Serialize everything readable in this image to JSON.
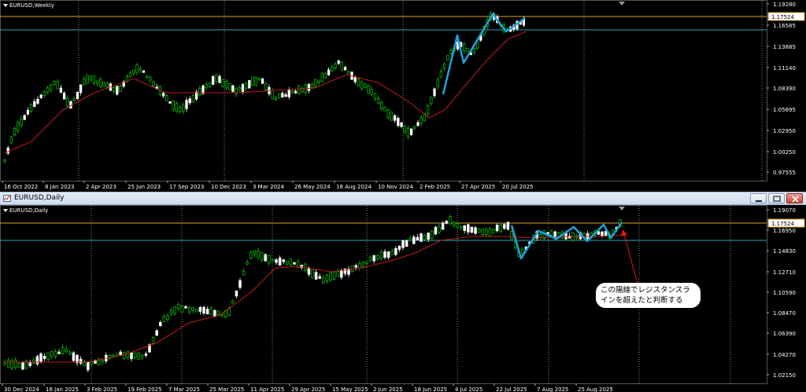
{
  "top_chart": {
    "label": "EURUSD,Weekly",
    "price_labels": [
      "1.19280",
      "1.16585",
      "1.13885",
      "1.11140",
      "1.08390",
      "1.05695",
      "1.02950",
      "1.00250",
      "0.97555"
    ],
    "current_price": "1.17524",
    "date_labels": [
      "16 Oct 2022",
      "8 Jan 2023",
      "2 Apr 2023",
      "25 Jun 2023",
      "17 Sep 2023",
      "10 Dec 2023",
      "3 Mar 2024",
      "26 May 2024",
      "18 Aug 2024",
      "10 Nov 2024",
      "2 Feb 2025",
      "27 Apr 2025",
      "20 Jul 2025"
    ]
  },
  "bottom_window": {
    "title": "EURUSD,Daily"
  },
  "bottom_chart": {
    "label": "EURUSD,Daily",
    "price_labels": [
      "1.19070",
      "1.16950",
      "1.14830",
      "1.12710",
      "1.10590",
      "1.08470",
      "1.06390",
      "1.04270",
      "1.02150"
    ],
    "current_price": "1.17524",
    "date_labels": [
      "30 Dec 2024",
      "16 Jan 2025",
      "3 Feb 2025",
      "19 Feb 2025",
      "7 Mar 2025",
      "25 Mar 2025",
      "11 Apr 2025",
      "29 Apr 2025",
      "15 May 2025",
      "2 Jun 2025",
      "18 Jun 2025",
      "4 Jul 2025",
      "22 Jul 2025",
      "7 Aug 2025",
      "25 Aug 2025"
    ]
  },
  "annotation": {
    "line1": "この陽線でレジスタンスラ",
    "line2": "インを超えたと判断する"
  },
  "colors": {
    "bull": "#00cc00",
    "bear": "#ffffff",
    "ma": "#c21a1a",
    "resistance": "#d9a032",
    "support": "#2fa6b3",
    "zigzag": "#1f9fd6",
    "arrow": "#e01818"
  }
}
